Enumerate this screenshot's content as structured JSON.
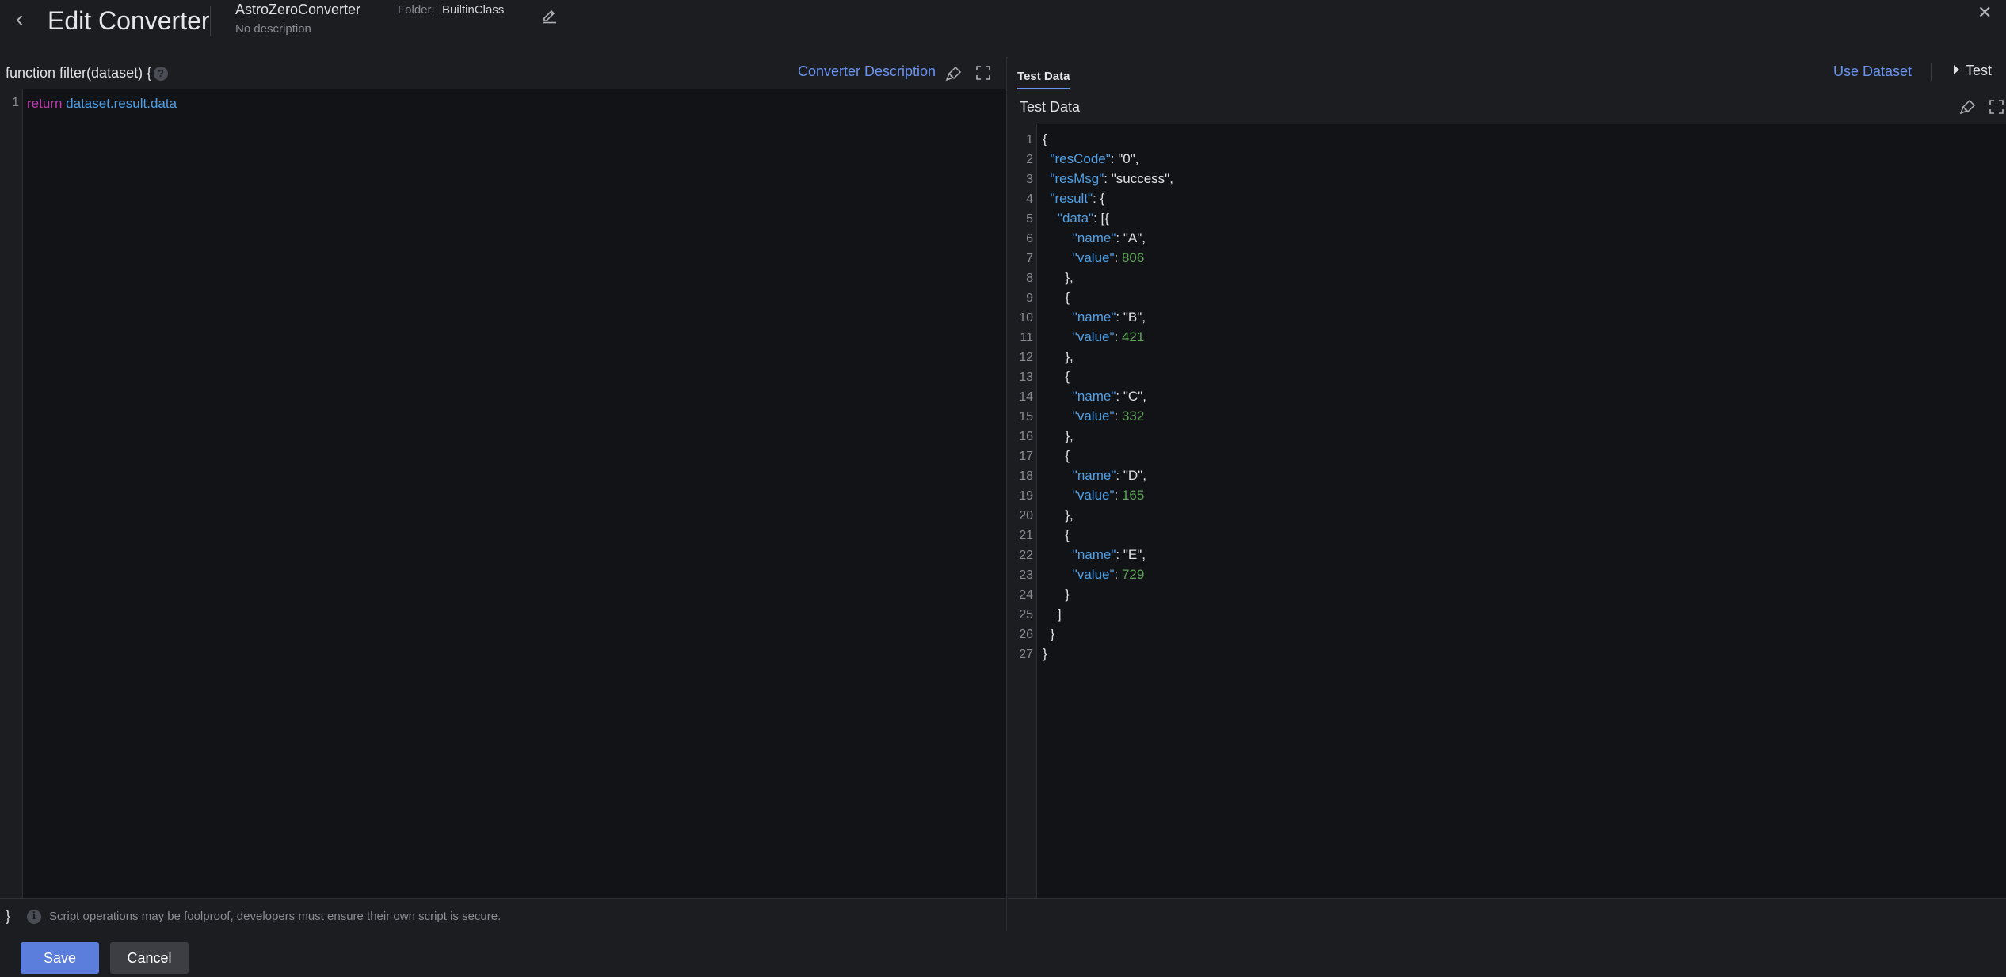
{
  "header": {
    "title": "Edit Converter",
    "converter_name": "AstroZeroConverter",
    "converter_description": "No description",
    "folder_label": "Folder:",
    "folder_value": "BuiltinClass"
  },
  "left_panel": {
    "function_signature": "function filter(dataset) {",
    "converter_description_link": "Converter Description",
    "code_lines": [
      {
        "number": "1",
        "keyword": "return",
        "expression": "dataset.result.data"
      }
    ],
    "closing_brace": "}",
    "info_text": "Script operations may be foolproof, developers must ensure their own script is secure."
  },
  "right_panel": {
    "tab_label": "Test Data",
    "use_dataset_label": "Use Dataset",
    "test_label": "Test",
    "section_title": "Test Data",
    "json_lines": [
      "{",
      "  \"resCode\": \"0\",",
      "  \"resMsg\": \"success\",",
      "  \"result\": {",
      "    \"data\": [{",
      "        \"name\": \"A\",",
      "        \"value\": 806",
      "      },",
      "      {",
      "        \"name\": \"B\",",
      "        \"value\": 421",
      "      },",
      "      {",
      "        \"name\": \"C\",",
      "        \"value\": 332",
      "      },",
      "      {",
      "        \"name\": \"D\",",
      "        \"value\": 165",
      "      },",
      "      {",
      "        \"name\": \"E\",",
      "        \"value\": 729",
      "      }",
      "    ]",
      "  }",
      "}"
    ]
  },
  "footer": {
    "save_label": "Save",
    "cancel_label": "Cancel"
  },
  "colors": {
    "accent": "#6b93f0",
    "primary_button": "#5b7ddb",
    "keyword": "#c239b3",
    "identifier": "#4fa0e6",
    "number": "#5fa55a"
  },
  "icons": {
    "back": "chevron-left-icon",
    "edit": "pencil-icon",
    "close": "close-icon",
    "help": "question-circle-icon",
    "format": "format-brush-icon",
    "fullscreen": "fullscreen-icon",
    "info": "info-circle-icon",
    "play": "play-triangle-icon"
  }
}
